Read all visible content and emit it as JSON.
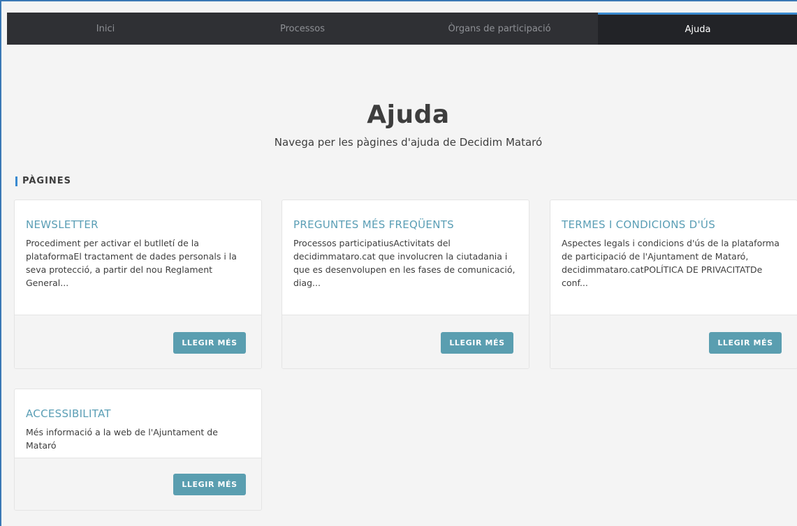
{
  "nav": {
    "tabs": [
      {
        "label": "Inici"
      },
      {
        "label": "Processos"
      },
      {
        "label": "Òrgans de participació"
      },
      {
        "label": "Ajuda"
      }
    ],
    "active": "Ajuda"
  },
  "hero": {
    "title": "Ajuda",
    "subtitle": "Navega per les pàgines d'ajuda de Decidim Mataró"
  },
  "section": {
    "title": "PÀGINES"
  },
  "cards": [
    {
      "title": "NEWSLETTER",
      "description": "Procediment per activar el butlletí de la plataformaEl tractament de dades personals i la seva protecció, a partir del nou Reglament General...",
      "button": "LLEGIR MÉS"
    },
    {
      "title": "PREGUNTES MÉS FREQÜENTS",
      "description": "Processos participatiusActivitats del decidimmataro.cat que involucren la ciutadania i que es desenvolupen en les fases de comunicació, diag...",
      "button": "LLEGIR MÉS"
    },
    {
      "title": "TERMES I CONDICIONS D'ÚS",
      "description": "Aspectes legals i condicions d'ús de la plataforma de participació de l'Ajuntament de Mataró, decidimmataro.catPOLÍTICA DE PRIVACITATDe conf...",
      "button": "LLEGIR MÉS"
    },
    {
      "title": "ACCESSIBILITAT",
      "description": "Més informació a la web de l'Ajuntament de Mataró",
      "button": "LLEGIR MÉS"
    }
  ],
  "colors": {
    "nav_bg": "#2f3034",
    "nav_active_bg": "#222327",
    "accent": "#3a8ad0",
    "card_title": "#5a9eb5",
    "button": "#5a9eb0"
  }
}
